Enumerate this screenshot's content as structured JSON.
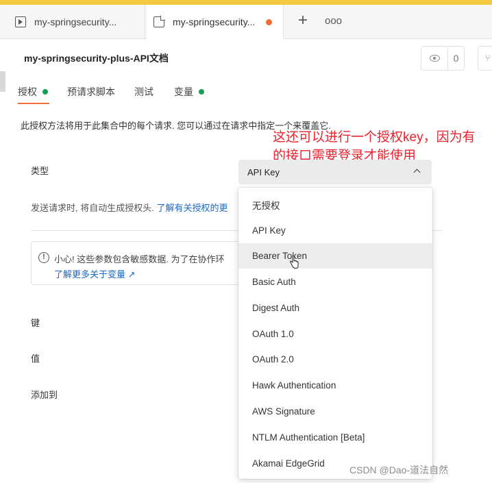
{
  "tabs": [
    {
      "label": "my-springsecurity...",
      "icon": "play-doc-icon"
    },
    {
      "label": "my-springsecurity...",
      "icon": "doc-icon",
      "unsaved": true
    }
  ],
  "tab_actions": {
    "add": "+",
    "more": "ooo"
  },
  "header": {
    "title": "my-springsecurity-plus-API文档",
    "watch_count": "0"
  },
  "subtabs": [
    {
      "label": "授权",
      "active": true,
      "dot": true
    },
    {
      "label": "预请求脚本",
      "active": false,
      "dot": false
    },
    {
      "label": "测试",
      "active": false,
      "dot": false
    },
    {
      "label": "变量",
      "active": false,
      "dot": true
    }
  ],
  "description": "此授权方法将用于此集合中的每个请求. 您可以通过在请求中指定一个来覆盖它.",
  "annotation": "这还可以进行一个授权key，因为有的接口需要登录才能使用",
  "auth": {
    "type_label": "类型",
    "selected": "API Key",
    "send_hint": "发送请求时, 将自动生成授权头. ",
    "send_hint_link": "了解有关授权的更",
    "options": [
      "无授权",
      "API Key",
      "Bearer Token",
      "Basic Auth",
      "Digest Auth",
      "OAuth 1.0",
      "OAuth 2.0",
      "Hawk Authentication",
      "AWS Signature",
      "NTLM Authentication [Beta]",
      "Akamai EdgeGrid"
    ],
    "hovered_option": "Bearer Token"
  },
  "warning": {
    "text": "小心! 这些参数包含敏感数据. 为了在协作环",
    "link": "了解更多关于变量 ↗"
  },
  "fields": {
    "key_label": "键",
    "value_label": "值",
    "add_to_label": "添加到"
  },
  "watermark": "CSDN @Dao-道法自然",
  "colors": {
    "accent_orange": "#f26b3a",
    "status_green": "#1a9e56",
    "link_blue": "#1a67c4",
    "annotation_red": "#e8232d"
  }
}
